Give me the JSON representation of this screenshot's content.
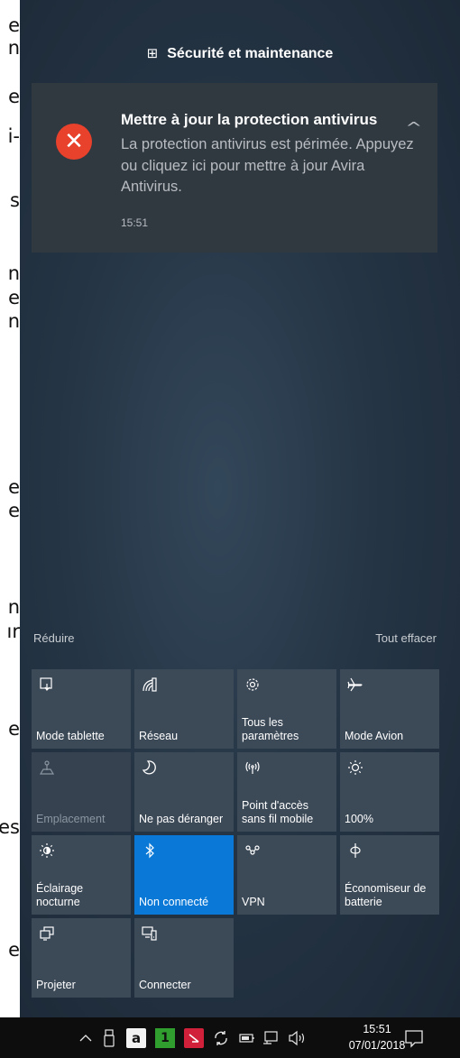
{
  "background_page": {
    "edge_letters": [
      "e",
      "n",
      "e",
      "i-",
      "s",
      "n",
      "e",
      "n",
      "e",
      "e",
      "n",
      "ır",
      "e",
      "es",
      "e"
    ]
  },
  "notification_group": {
    "app_name": "Sécurité et maintenance",
    "icon": "shield-grid-icon"
  },
  "notification": {
    "title": "Mettre à jour la protection antivirus",
    "body": "La protection antivirus est périmée. Appuyez ou cliquez ici pour mettre à jour Avira Antivirus.",
    "time": "15:51",
    "icon": "error-x-icon",
    "error_color": "#e8412c"
  },
  "actions": {
    "collapse_label": "Réduire",
    "clear_all_label": "Tout effacer"
  },
  "quick_actions": [
    {
      "label": "Mode tablette",
      "icon": "tablet-mode-icon",
      "state": "off"
    },
    {
      "label": "Réseau",
      "icon": "network-icon",
      "state": "off"
    },
    {
      "label": "Tous les paramètres",
      "icon": "settings-gear-icon",
      "state": "off"
    },
    {
      "label": "Mode Avion",
      "icon": "airplane-icon",
      "state": "off"
    },
    {
      "label": "Emplacement",
      "icon": "location-icon",
      "state": "disabled"
    },
    {
      "label": "Ne pas déranger",
      "icon": "moon-icon",
      "state": "off"
    },
    {
      "label": "Point d'accès sans fil mobile",
      "icon": "hotspot-icon",
      "state": "off"
    },
    {
      "label": "100%",
      "icon": "brightness-icon",
      "state": "off"
    },
    {
      "label": "Éclairage nocturne",
      "icon": "night-light-icon",
      "state": "off"
    },
    {
      "label": "Non connecté",
      "icon": "bluetooth-icon",
      "state": "on"
    },
    {
      "label": "VPN",
      "icon": "vpn-icon",
      "state": "off"
    },
    {
      "label": "Économiseur de batterie",
      "icon": "battery-saver-icon",
      "state": "off"
    },
    {
      "label": "Projeter",
      "icon": "project-icon",
      "state": "off"
    },
    {
      "label": "Connecter",
      "icon": "connect-icon",
      "state": "off"
    }
  ],
  "taskbar": {
    "time": "15:51",
    "date": "07/01/2018",
    "tray_a_label": "a",
    "tray_one_label": "1",
    "tray_icons": [
      "chevron-up-icon",
      "usb-icon",
      "amazon-a-icon",
      "green-one-icon",
      "red-app-icon",
      "sync-icon",
      "battery-icon",
      "network-monitor-icon",
      "volume-icon"
    ]
  },
  "colors": {
    "accent": "#0a78d7",
    "tile": "#3c4957",
    "notification_bg": "#303840",
    "taskbar": "#0d0d0d"
  }
}
